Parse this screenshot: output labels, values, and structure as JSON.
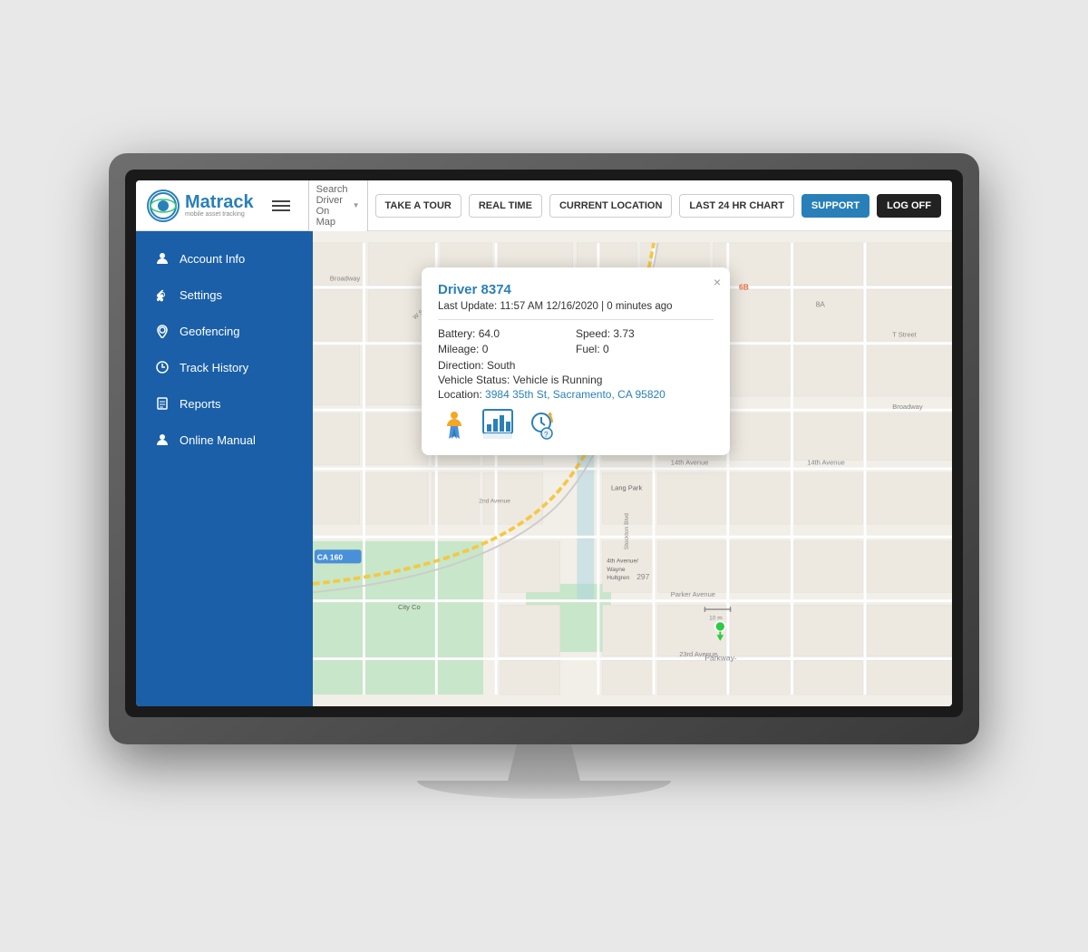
{
  "logo": {
    "name": "Matrack",
    "subtitle": "mobile asset tracking"
  },
  "navbar": {
    "search_placeholder": "Search Driver On Map",
    "take_tour_label": "TAKE A TOUR",
    "real_time_label": "REAL TIME",
    "current_location_label": "CURRENT LOCATION",
    "last_chart_label": "LAST 24 HR CHART",
    "support_label": "SUPPORT",
    "logoff_label": "LOG OFF"
  },
  "sidebar": {
    "items": [
      {
        "id": "account-info",
        "label": "Account Info",
        "icon": "👤"
      },
      {
        "id": "settings",
        "label": "Settings",
        "icon": "⚙"
      },
      {
        "id": "geofencing",
        "label": "Geofencing",
        "icon": "📍"
      },
      {
        "id": "track-history",
        "label": "Track History",
        "icon": "🔄"
      },
      {
        "id": "reports",
        "label": "Reports",
        "icon": "📋"
      },
      {
        "id": "online-manual",
        "label": "Online Manual",
        "icon": "👤"
      }
    ]
  },
  "popup": {
    "driver_name": "Driver 8374",
    "last_update": "Last Update: 11:57 AM 12/16/2020 | 0 minutes ago",
    "battery_label": "Battery:",
    "battery_value": "64.0",
    "speed_label": "Speed:",
    "speed_value": "3.73",
    "mileage_label": "Mileage:",
    "mileage_value": "0",
    "fuel_label": "Fuel:",
    "fuel_value": "0",
    "direction_label": "Direction:",
    "direction_value": "South",
    "status_label": "Vehicle Status:",
    "status_value": "Vehicle is Running",
    "location_label": "Location:",
    "location_value": "3984 35th St, Sacramento, CA 95820",
    "close_label": "×"
  }
}
